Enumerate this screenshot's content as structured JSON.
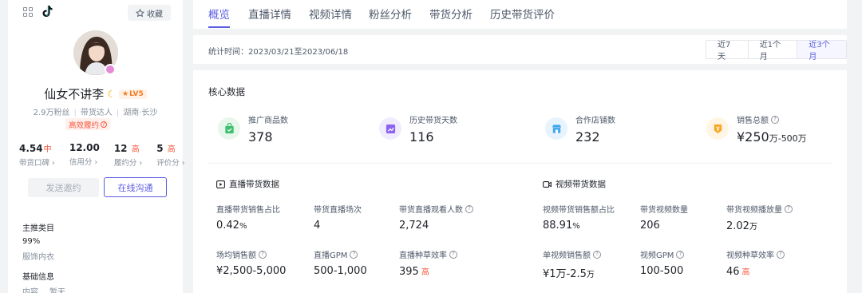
{
  "profile": {
    "fav_label": "收藏",
    "name": "仙女不讲李",
    "level": "LV5",
    "fans": "2.9万粉丝",
    "role": "带货达人",
    "location": "湖南·长沙",
    "hq_tag": "高效履约",
    "stats": [
      {
        "value": "4.54",
        "tag": "中",
        "label": "带货口碑"
      },
      {
        "value": "12.00",
        "tag": "",
        "label": "信用分"
      },
      {
        "value": "12",
        "tag": "高",
        "label": "履约分"
      },
      {
        "value": "5",
        "tag": "高",
        "label": "评价分"
      }
    ],
    "invite_label": "发送邀约",
    "chat_label": "在线沟通",
    "main_category_title": "主推类目",
    "main_category_pct": "99%",
    "main_category_name": "服饰内衣",
    "basic_info_title": "基础信息",
    "basic_info_key": "内容",
    "basic_info_val": "暂无"
  },
  "tabs": [
    "概览",
    "直播详情",
    "视频详情",
    "粉丝分析",
    "带货分析",
    "历史带货评价"
  ],
  "time": {
    "label": "统计时间：2023/03/21至2023/06/18",
    "ranges": [
      "近7天",
      "近1个月",
      "近3个月"
    ],
    "active_range": "近3个月"
  },
  "core": {
    "title": "核心数据",
    "kpis": [
      {
        "label": "推广商品数",
        "value": "378",
        "unit": "",
        "color": "#e8f7ec",
        "icon": "bag-icon"
      },
      {
        "label": "历史带货天数",
        "value": "116",
        "unit": "",
        "color": "#f1ecfd",
        "icon": "trend-icon"
      },
      {
        "label": "合作店铺数",
        "value": "232",
        "unit": "",
        "color": "#e7f3fd",
        "icon": "store-icon"
      },
      {
        "label": "销售总额",
        "value": "¥250",
        "unit": "万-500万",
        "color": "#fff5e4",
        "icon": "coin-icon"
      }
    ],
    "live_title": "直播带货数据",
    "video_title": "视频带货数据",
    "live_metrics": [
      {
        "label": "直播带货销售占比",
        "value": "0.42",
        "unit": "%",
        "tag": ""
      },
      {
        "label": "带货直播场次",
        "value": "4",
        "unit": "",
        "tag": ""
      },
      {
        "label": "带货直播观看人数",
        "value": "2,724",
        "unit": "",
        "tag": ""
      },
      {
        "label": "场均销售额",
        "value": "¥2,500-5,000",
        "unit": "",
        "tag": ""
      },
      {
        "label": "直播GPM",
        "value": "500-1,000",
        "unit": "",
        "tag": ""
      },
      {
        "label": "直播种草效率",
        "value": "395",
        "unit": "",
        "tag": "高"
      }
    ],
    "video_metrics": [
      {
        "label": "视频带货销售额占比",
        "value": "88.91",
        "unit": "%",
        "tag": ""
      },
      {
        "label": "带货视频数量",
        "value": "206",
        "unit": "",
        "tag": ""
      },
      {
        "label": "带货视频播放量",
        "value": "2.02",
        "unit": "万",
        "tag": ""
      },
      {
        "label": "单视频销售额",
        "value": "¥1万-2.5",
        "unit": "万",
        "tag": ""
      },
      {
        "label": "视频GPM",
        "value": "100-500",
        "unit": "",
        "tag": ""
      },
      {
        "label": "视频种草效率",
        "value": "46",
        "unit": "",
        "tag": "高"
      }
    ]
  }
}
